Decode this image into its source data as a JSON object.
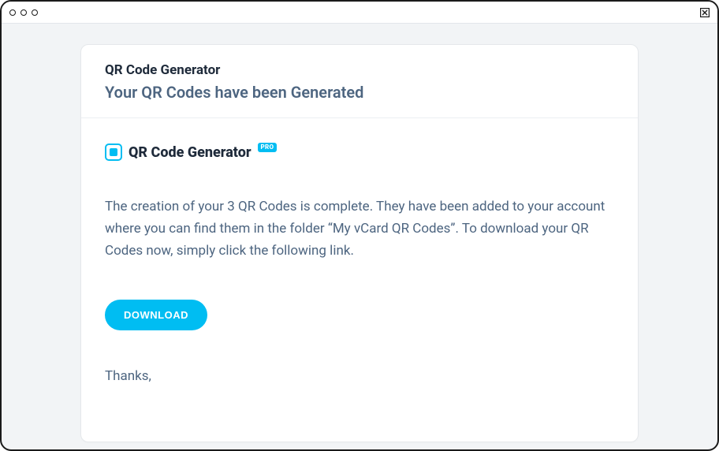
{
  "email": {
    "sender": "QR Code Generator",
    "subject": "Your QR Codes have been Generated"
  },
  "brand": {
    "name": "QR Code Generator",
    "badge": "PRO"
  },
  "body": {
    "message": "The creation of your 3 QR Codes is complete. They have been added to your account where you can find them in the folder “My vCard QR Codes”. To download your QR Codes now, simply click the following link.",
    "cta": "DOWNLOAD",
    "signoff": "Thanks,"
  },
  "colors": {
    "accent": "#00bdf2",
    "text_primary": "#1e2a3a",
    "text_secondary": "#4d6580"
  }
}
